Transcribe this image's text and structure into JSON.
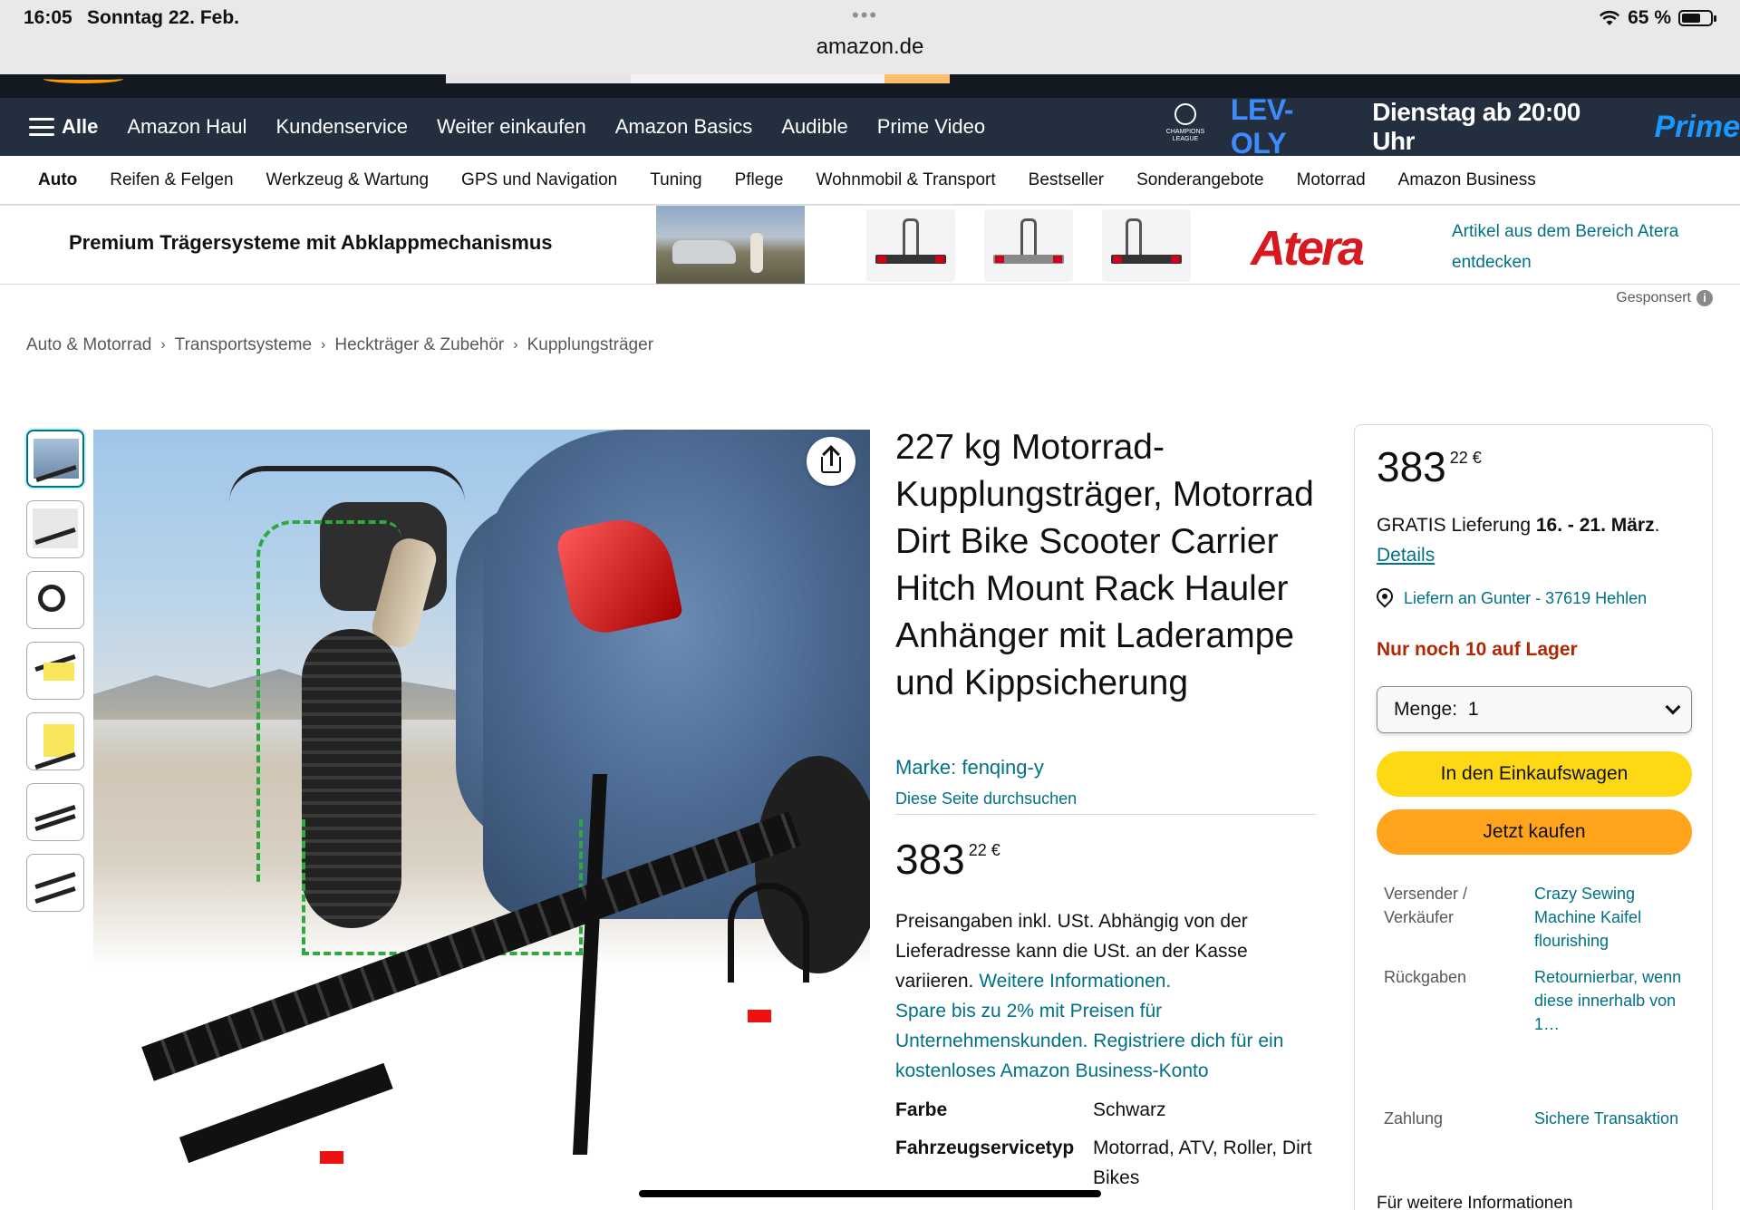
{
  "status_bar": {
    "time": "16:05",
    "date": "Sonntag 22. Feb.",
    "battery": "65 %",
    "url": "amazon.de",
    "battery_level": 0.65
  },
  "nav": {
    "all_label": "Alle",
    "items": [
      "Amazon Haul",
      "Kundenservice",
      "Weiter einkaufen",
      "Amazon Basics",
      "Audible",
      "Prime Video"
    ],
    "promo": {
      "logo_text": "CHAMPIONS LEAGUE",
      "match": "LEV-OLY",
      "date": "Dienstag ab 20:00 Uhr",
      "brand": "Prime"
    }
  },
  "subnav": {
    "items": [
      "Auto",
      "Reifen & Felgen",
      "Werkzeug & Wartung",
      "GPS und Navigation",
      "Tuning",
      "Pflege",
      "Wohnmobil & Transport",
      "Bestseller",
      "Sonderangebote",
      "Motorrad",
      "Amazon Business"
    ]
  },
  "banner": {
    "title": "Premium Trägersysteme mit Abklappmechanismus",
    "brand": "Atera",
    "link": "Artikel aus dem Bereich Atera entdecken",
    "sponsored": "Gesponsert"
  },
  "breadcrumb": [
    "Auto & Motorrad",
    "Transportsysteme",
    "Heckträger & Zubehör",
    "Kupplungsträger"
  ],
  "product": {
    "title": "227 kg Motorrad-Kupplungsträger, Motorrad Dirt Bike Scooter Carrier Hitch Mount Rack Hauler Anhänger mit Laderampe und Kippsicherung",
    "brand_link": "Marke: fenqing-y",
    "store_link": "Diese Seite durchsuchen",
    "price_whole": "383",
    "price_frac": "22 €",
    "tax_text": "Preisangaben inkl. USt. Abhängig von der Lieferadresse kann die USt. an der Kasse variieren.",
    "tax_link": "Weitere Informationen.",
    "business_text": "Spare bis zu 2% mit Preisen für Unternehmenskunden. Registriere dich für ein kostenloses Amazon Business-Konto",
    "specs": [
      {
        "key": "Farbe",
        "value": "Schwarz"
      },
      {
        "key": "Fahrzeugservicetyp",
        "value": "Motorrad, ATV, Roller, Dirt Bikes"
      }
    ]
  },
  "buybox": {
    "price_whole": "383",
    "price_frac": "22 €",
    "delivery_prefix": "GRATIS Lieferung",
    "delivery_date": "16. - 21. März",
    "delivery_suffix": ".",
    "details": "Details",
    "location": "Liefern an Gunter - 37619 Hehlen",
    "stock": "Nur noch 10 auf Lager",
    "qty_label": "Menge:",
    "qty_value": "1",
    "cart_button": "In den Einkaufswagen",
    "buy_button": "Jetzt kaufen",
    "info": [
      {
        "key": "Versender / Verkäufer",
        "value": "Crazy Sewing Machine Kaifel flourishing"
      },
      {
        "key": "Rückgaben",
        "value": "Retournierbar, wenn diese innerhalb von 1…"
      },
      {
        "key": "Zahlung",
        "value": "Sichere Transaktion"
      }
    ],
    "more_info": "Für weitere Informationen"
  }
}
